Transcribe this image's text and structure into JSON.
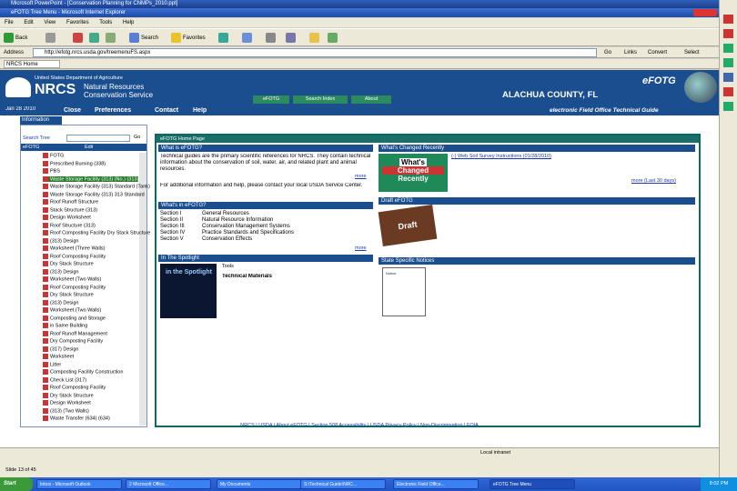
{
  "ppt_window": {
    "title": "Microsoft PowerPoint - [Conservation Planning for CNMPs_2010.ppt]"
  },
  "ie_window": {
    "title": "eFOTG Tree Menu - Microsoft Internet Explorer"
  },
  "menu": [
    "File",
    "Edit",
    "View",
    "Favorites",
    "Tools",
    "Help"
  ],
  "toolbar": {
    "back": "Back",
    "search": "Search",
    "favorites": "Favorites",
    "go": "Go",
    "links": "Links",
    "convert": "Convert",
    "select": "Select"
  },
  "address": {
    "label": "Address",
    "value": "http://efotg.nrcs.usda.gov/treemenuFS.aspx"
  },
  "links_bar": {
    "item": "NRCS Home"
  },
  "site": {
    "agency": "United States Department of Agriculture",
    "nrcs": "NRCS",
    "name_line1": "Natural Resources",
    "name_line2": "Conservation Service",
    "county": "ALACHUA COUNTY, FL",
    "efotg": "eFOTG",
    "tagline": "electronic Field Office Technical Guide",
    "tabs": [
      "eFOTG",
      "Search Index",
      "About"
    ],
    "date": "Jan 28 2010",
    "subnav": [
      "Close",
      "Preferences",
      "Contact",
      "Help"
    ],
    "info_tab": "Information"
  },
  "sidebar": {
    "search_label": "Search Tree",
    "go": "Go",
    "col1": "eFOTG",
    "col2": "Edit",
    "items": [
      "FOTG",
      "Prescribed Burning (338)",
      "PBS",
      "Waste Storage Facility (313) (No.) (313)",
      "Waste Storage Facility (313) Standard (Tank)",
      "Waste Storage Facility (313) 313 Standard",
      "Roof Runoff Structure",
      "Stack Structure (313)",
      "Design Worksheet",
      "Roof Structure (313)",
      "Roof Composting Facility Dry Stack Structure",
      "(313) Design",
      "Worksheet (Three Walls)",
      "Roof Composting Facility",
      "Dry Stack Structure",
      "(313) Design",
      "Worksheet (Two Walls)",
      "Roof Composting Facility",
      "Dry Stack Structure",
      "(313) Design",
      "Worksheet (Two Walls)",
      "Composting and Storage",
      "in Same Building",
      "Roof Runoff Management",
      "Dry Composting Facility",
      "(317) Design",
      "Worksheet",
      "Litter",
      "Composting Facility Construction",
      "Check List (317)",
      "Roof Composting Facility",
      "Dry Stack Structure",
      "Design Worksheet",
      "(313) (Two Walls)",
      "Waste Transfer (634) (634)"
    ]
  },
  "main": {
    "crumb": "eFOTG Home Page",
    "what_title": "What is eFOTG?",
    "what_text": "Technical guides are the primary scientific references for NRCS. They contain technical information about the conservation of soil, water, air, and related plant and animal resources.",
    "more": "more",
    "contact_text": "For additional information and help, please contact your local USDA Service Center.",
    "in_title": "What's in eFOTG?",
    "sections": [
      {
        "name": "Section I",
        "desc": "General Resources"
      },
      {
        "name": "Section II",
        "desc": "Natural Resource Information"
      },
      {
        "name": "Section III",
        "desc": "Conservation Management Systems"
      },
      {
        "name": "Section IV",
        "desc": "Practice Standards and Specifications"
      },
      {
        "name": "Section V",
        "desc": "Conservation Effects"
      }
    ],
    "spotlight_title": "In The Spotlight",
    "spotlight_img": "in the Spotlight",
    "spotlight_tools": "Tools",
    "spotlight_link": "Technical Materials",
    "changed_title": "What's Changed Recently",
    "changed_img1": "What's",
    "changed_img2": "Changed",
    "changed_img3": "Recently",
    "changed_link": "(-) Web Soil Survey Instructions (01/28/2010)",
    "changed_more": "more (Last 30 days)",
    "draft_title": "Draft eFOTG",
    "draft_img": "Draft",
    "state_title": "State Specific Notices",
    "doc_img": "Notice"
  },
  "footer": "NRCS | USDA | About eFOTG | Section 508 Accessibility | USDA Privacy Policy | Non-Discrimination | FOIA",
  "status": {
    "zone": "Local intranet"
  },
  "ppt_strip": {
    "slide": "Slide 13 of 45"
  },
  "taskbar": {
    "start": "Start",
    "tasks": [
      "Inbox - Microsoft Outlook",
      "2 Microsoft Office...",
      "My Documents",
      "S:\\Technical Guide\\NRC...",
      "Electronic Field Office...",
      "eFOTG Tree Menu"
    ],
    "clock": "8:02 PM"
  }
}
